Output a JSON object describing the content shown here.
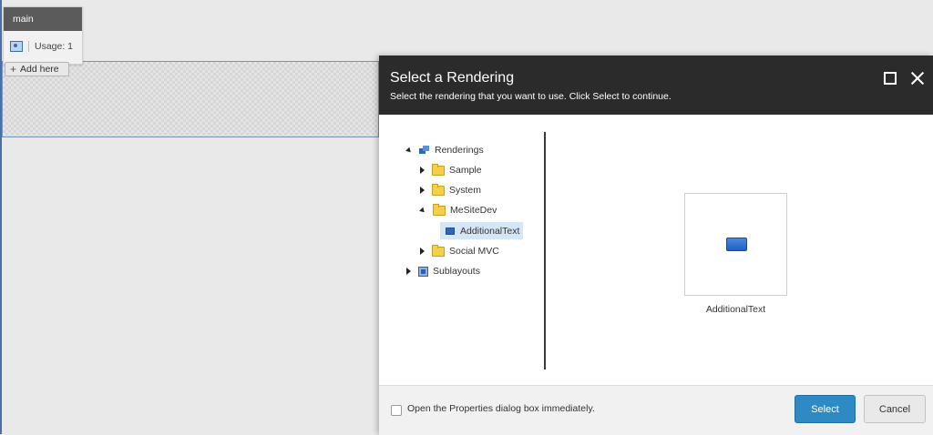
{
  "placeholder": {
    "name": "main",
    "usage": "Usage: 1",
    "add_here": "Add here"
  },
  "dialog": {
    "title": "Select a Rendering",
    "subtitle": "Select the rendering that you want to use. Click Select to continue.",
    "tree": {
      "root": "Renderings",
      "items": [
        "Sample",
        "System",
        "MeSiteDev",
        "AdditionalText",
        "Social MVC"
      ],
      "sublayouts": "Sublayouts"
    },
    "preview": {
      "label": "AdditionalText"
    },
    "footer": {
      "checkbox_label": "Open the Properties dialog box immediately.",
      "select_label": "Select",
      "cancel_label": "Cancel"
    }
  }
}
